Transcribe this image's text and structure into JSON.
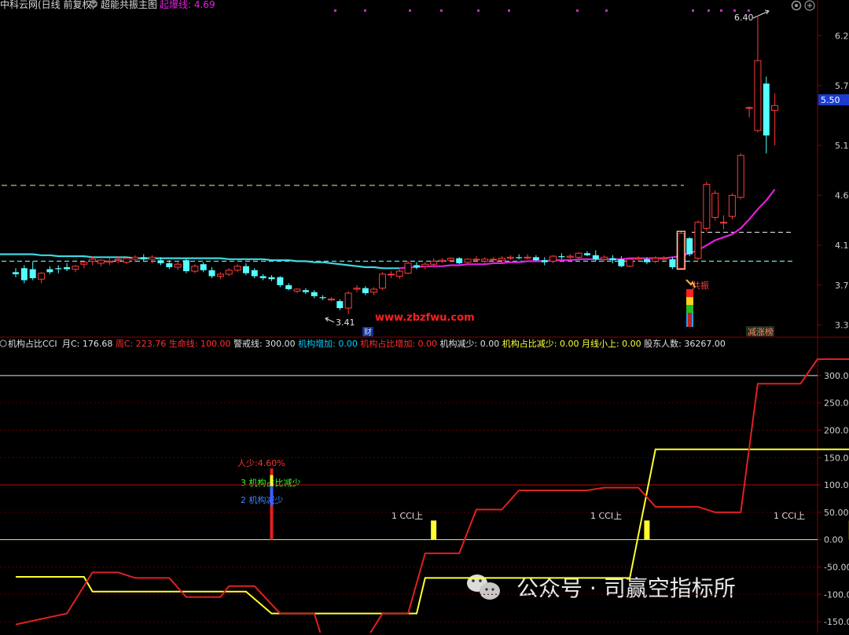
{
  "top_bar": {
    "app_text": "中科云网(日线 前复权)",
    "indicator_name": "超能共振主图",
    "breakout_label": "起爆线: 4.69",
    "breakout_value": 4.69,
    "settings_icon": "gear-icon",
    "zoom_icon": "plus-circle-icon"
  },
  "price_axis": {
    "ticks": [
      "6.2",
      "5.7",
      "5.1",
      "4.6",
      "4.1",
      "3.7",
      "3.3"
    ],
    "current_price_label": "5.50"
  },
  "main_annotations": {
    "high_label": "6.40",
    "low_label": "3.41",
    "finance_badge": "财",
    "resonance_label": "共振",
    "dragon_tiger_badge": "减涨榜",
    "watermark": "www.zbzfwu.com"
  },
  "sub_header": {
    "title": "机构占比CCI",
    "items": [
      {
        "label": "月C:",
        "value": "176.68",
        "color": "#e0e0e0"
      },
      {
        "label": "周C:",
        "value": "223.76",
        "color": "#ff3030"
      },
      {
        "label": "生命线:",
        "value": "100.00",
        "color": "#ff3030"
      },
      {
        "label": "警戒线:",
        "value": "300.00",
        "color": "#e0e0e0"
      },
      {
        "label": "机构增加:",
        "value": "0.00",
        "color": "#00cfff"
      },
      {
        "label": "机构占比增加:",
        "value": "0.00",
        "color": "#ff3030"
      },
      {
        "label": "机构减少:",
        "value": "0.00",
        "color": "#e0e0e0"
      },
      {
        "label": "机构占比减少:",
        "value": "0.00",
        "color": "#ffff40"
      },
      {
        "label": "月线小上:",
        "value": "0.00",
        "color": "#ffff40"
      },
      {
        "label": "股东人数:",
        "value": "36267.00",
        "color": "#e0e0e0"
      }
    ]
  },
  "cci_axis": {
    "ticks": [
      "300.00",
      "250.00",
      "200.00",
      "150.00",
      "100.00",
      "50.00",
      "0.00",
      "-50.00",
      "-100.00",
      "-150.00"
    ]
  },
  "cci_annotations": {
    "reduce_pct": "人少:4.60%",
    "ratio_reduce": "3 机构占比减少",
    "inst_reduce": "2 机构减少",
    "cci_up_1": "1 CCI上",
    "cci_up_2": "1 CCI上",
    "cci_up_3": "1 CCI上"
  },
  "footer_watermark": {
    "text": "公众号 · 司赢空指标所",
    "icon": "wechat-icon"
  },
  "colors": {
    "up": "#ff3a3a",
    "down": "#54ffff",
    "ma_cyan": "#3fd8e0",
    "ma_magenta": "#e020e0",
    "dashed_yellow": "#c8b878",
    "grid_red": "#8b0000",
    "monthly_cci": "#ffff30",
    "weekly_cci": "#e02020"
  },
  "chart_data": [
    {
      "type": "candlestick",
      "title": "超能共振主图",
      "ylim": [
        3.25,
        6.4
      ],
      "y_ticks": [
        6.2,
        5.7,
        5.1,
        4.6,
        4.1,
        3.7,
        3.3
      ],
      "candles": [
        {
          "o": 3.83,
          "h": 3.87,
          "l": 3.78,
          "c": 3.81
        },
        {
          "o": 3.87,
          "h": 3.9,
          "l": 3.72,
          "c": 3.75
        },
        {
          "o": 3.86,
          "h": 3.94,
          "l": 3.75,
          "c": 3.77
        },
        {
          "o": 3.76,
          "h": 3.83,
          "l": 3.72,
          "c": 3.82
        },
        {
          "o": 3.86,
          "h": 3.89,
          "l": 3.81,
          "c": 3.83
        },
        {
          "o": 3.87,
          "h": 3.9,
          "l": 3.82,
          "c": 3.86
        },
        {
          "o": 3.88,
          "h": 3.92,
          "l": 3.84,
          "c": 3.86
        },
        {
          "o": 3.86,
          "h": 3.9,
          "l": 3.83,
          "c": 3.89
        },
        {
          "o": 3.91,
          "h": 3.94,
          "l": 3.87,
          "c": 3.93
        },
        {
          "o": 3.94,
          "h": 3.99,
          "l": 3.9,
          "c": 3.96
        },
        {
          "o": 3.92,
          "h": 3.96,
          "l": 3.89,
          "c": 3.95
        },
        {
          "o": 3.93,
          "h": 3.97,
          "l": 3.9,
          "c": 3.94
        },
        {
          "o": 3.95,
          "h": 3.99,
          "l": 3.92,
          "c": 3.96
        },
        {
          "o": 3.93,
          "h": 3.98,
          "l": 3.91,
          "c": 3.97
        },
        {
          "o": 3.96,
          "h": 4.0,
          "l": 3.93,
          "c": 3.98
        },
        {
          "o": 3.98,
          "h": 4.01,
          "l": 3.94,
          "c": 3.96
        },
        {
          "o": 3.96,
          "h": 4.0,
          "l": 3.92,
          "c": 3.98
        },
        {
          "o": 3.95,
          "h": 3.98,
          "l": 3.9,
          "c": 3.92
        },
        {
          "o": 3.92,
          "h": 3.95,
          "l": 3.86,
          "c": 3.88
        },
        {
          "o": 3.88,
          "h": 3.94,
          "l": 3.85,
          "c": 3.91
        },
        {
          "o": 3.95,
          "h": 3.97,
          "l": 3.82,
          "c": 3.84
        },
        {
          "o": 3.84,
          "h": 3.91,
          "l": 3.82,
          "c": 3.89
        },
        {
          "o": 3.91,
          "h": 3.93,
          "l": 3.83,
          "c": 3.85
        },
        {
          "o": 3.85,
          "h": 3.88,
          "l": 3.77,
          "c": 3.79
        },
        {
          "o": 3.79,
          "h": 3.83,
          "l": 3.76,
          "c": 3.81
        },
        {
          "o": 3.81,
          "h": 3.87,
          "l": 3.79,
          "c": 3.85
        },
        {
          "o": 3.85,
          "h": 3.91,
          "l": 3.83,
          "c": 3.89
        },
        {
          "o": 3.89,
          "h": 3.92,
          "l": 3.8,
          "c": 3.82
        },
        {
          "o": 3.85,
          "h": 3.87,
          "l": 3.77,
          "c": 3.79
        },
        {
          "o": 3.79,
          "h": 3.81,
          "l": 3.75,
          "c": 3.77
        },
        {
          "o": 3.78,
          "h": 3.8,
          "l": 3.74,
          "c": 3.76
        },
        {
          "o": 3.78,
          "h": 3.79,
          "l": 3.68,
          "c": 3.7
        },
        {
          "o": 3.7,
          "h": 3.72,
          "l": 3.65,
          "c": 3.66
        },
        {
          "o": 3.64,
          "h": 3.67,
          "l": 3.62,
          "c": 3.66
        },
        {
          "o": 3.65,
          "h": 3.67,
          "l": 3.61,
          "c": 3.63
        },
        {
          "o": 3.63,
          "h": 3.65,
          "l": 3.57,
          "c": 3.59
        },
        {
          "o": 3.58,
          "h": 3.6,
          "l": 3.55,
          "c": 3.57
        },
        {
          "o": 3.56,
          "h": 3.58,
          "l": 3.54,
          "c": 3.56
        },
        {
          "o": 3.54,
          "h": 3.56,
          "l": 3.45,
          "c": 3.47
        },
        {
          "o": 3.47,
          "h": 3.64,
          "l": 3.41,
          "c": 3.62
        },
        {
          "o": 3.66,
          "h": 3.7,
          "l": 3.63,
          "c": 3.67
        },
        {
          "o": 3.67,
          "h": 3.69,
          "l": 3.6,
          "c": 3.62
        },
        {
          "o": 3.63,
          "h": 3.68,
          "l": 3.6,
          "c": 3.66
        },
        {
          "o": 3.67,
          "h": 3.83,
          "l": 3.65,
          "c": 3.81
        },
        {
          "o": 3.81,
          "h": 3.84,
          "l": 3.77,
          "c": 3.81
        },
        {
          "o": 3.79,
          "h": 3.86,
          "l": 3.76,
          "c": 3.84
        },
        {
          "o": 3.82,
          "h": 3.94,
          "l": 3.81,
          "c": 3.92
        },
        {
          "o": 3.9,
          "h": 3.93,
          "l": 3.86,
          "c": 3.88
        },
        {
          "o": 3.89,
          "h": 3.93,
          "l": 3.86,
          "c": 3.91
        },
        {
          "o": 3.91,
          "h": 3.97,
          "l": 3.89,
          "c": 3.94
        },
        {
          "o": 3.94,
          "h": 3.97,
          "l": 3.92,
          "c": 3.95
        },
        {
          "o": 3.95,
          "h": 3.98,
          "l": 3.93,
          "c": 3.97
        },
        {
          "o": 3.97,
          "h": 3.98,
          "l": 3.91,
          "c": 3.92
        },
        {
          "o": 3.93,
          "h": 3.97,
          "l": 3.91,
          "c": 3.96
        },
        {
          "o": 3.96,
          "h": 3.99,
          "l": 3.93,
          "c": 3.96
        },
        {
          "o": 3.94,
          "h": 3.98,
          "l": 3.92,
          "c": 3.96
        },
        {
          "o": 3.96,
          "h": 3.98,
          "l": 3.93,
          "c": 3.96
        },
        {
          "o": 3.95,
          "h": 3.99,
          "l": 3.93,
          "c": 3.97
        },
        {
          "o": 3.97,
          "h": 4.0,
          "l": 3.95,
          "c": 3.98
        },
        {
          "o": 3.98,
          "h": 4.01,
          "l": 3.96,
          "c": 3.97
        },
        {
          "o": 3.98,
          "h": 4.01,
          "l": 3.96,
          "c": 3.98
        },
        {
          "o": 3.98,
          "h": 4.0,
          "l": 3.94,
          "c": 3.95
        },
        {
          "o": 3.95,
          "h": 3.98,
          "l": 3.9,
          "c": 3.93
        },
        {
          "o": 3.94,
          "h": 4.0,
          "l": 3.92,
          "c": 3.99
        },
        {
          "o": 3.99,
          "h": 4.02,
          "l": 3.96,
          "c": 3.98
        },
        {
          "o": 3.98,
          "h": 4.01,
          "l": 3.96,
          "c": 3.99
        },
        {
          "o": 3.98,
          "h": 4.03,
          "l": 3.96,
          "c": 4.02
        },
        {
          "o": 4.02,
          "h": 4.04,
          "l": 3.99,
          "c": 4.0
        },
        {
          "o": 4.0,
          "h": 4.05,
          "l": 3.94,
          "c": 3.96
        },
        {
          "o": 3.96,
          "h": 4.0,
          "l": 3.94,
          "c": 3.98
        },
        {
          "o": 3.97,
          "h": 4.0,
          "l": 3.92,
          "c": 3.95
        },
        {
          "o": 3.96,
          "h": 3.99,
          "l": 3.88,
          "c": 3.89
        },
        {
          "o": 3.89,
          "h": 3.97,
          "l": 3.88,
          "c": 3.96
        },
        {
          "o": 3.96,
          "h": 3.99,
          "l": 3.94,
          "c": 3.97
        },
        {
          "o": 3.96,
          "h": 3.98,
          "l": 3.91,
          "c": 3.93
        },
        {
          "o": 3.94,
          "h": 3.99,
          "l": 3.92,
          "c": 3.97
        },
        {
          "o": 3.96,
          "h": 3.99,
          "l": 3.93,
          "c": 3.97
        },
        {
          "o": 3.96,
          "h": 3.98,
          "l": 3.86,
          "c": 3.88
        },
        {
          "o": 3.87,
          "h": 4.24,
          "l": 3.86,
          "c": 4.22
        },
        {
          "o": 4.17,
          "h": 4.18,
          "l": 3.99,
          "c": 4.01
        },
        {
          "o": 3.97,
          "h": 4.35,
          "l": 3.95,
          "c": 4.33
        },
        {
          "o": 4.27,
          "h": 4.74,
          "l": 4.24,
          "c": 4.71
        },
        {
          "o": 4.38,
          "h": 4.65,
          "l": 4.35,
          "c": 4.62
        },
        {
          "o": 4.33,
          "h": 4.4,
          "l": 4.26,
          "c": 4.33
        },
        {
          "o": 4.39,
          "h": 4.62,
          "l": 4.36,
          "c": 4.6
        },
        {
          "o": 4.58,
          "h": 5.02,
          "l": 4.56,
          "c": 5.0
        },
        {
          "o": 5.48,
          "h": 5.49,
          "l": 5.38,
          "c": 5.48
        },
        {
          "o": 5.25,
          "h": 6.4,
          "l": 5.23,
          "c": 5.95
        },
        {
          "o": 5.72,
          "h": 5.79,
          "l": 5.02,
          "c": 5.2
        },
        {
          "o": 5.45,
          "h": 5.62,
          "l": 5.1,
          "c": 5.5
        }
      ],
      "ma_long": [
        4.01,
        4.01,
        4.01,
        4.0,
        4.0,
        3.99,
        3.99,
        3.99,
        3.99,
        3.98,
        3.98,
        3.98,
        3.98,
        3.98,
        3.97,
        3.97,
        3.97,
        3.97,
        3.97,
        3.97,
        3.97,
        3.97,
        3.97,
        3.97,
        3.97,
        3.96,
        3.96,
        3.96,
        3.96,
        3.96,
        3.95,
        3.95,
        3.95,
        3.94,
        3.94,
        3.93,
        3.93,
        3.92,
        3.91,
        3.9,
        3.89,
        3.88,
        3.88,
        3.87,
        3.87,
        3.87,
        3.88,
        3.88,
        3.89,
        3.89,
        3.89,
        3.9,
        3.9,
        3.91,
        3.91,
        3.91,
        3.92,
        3.92,
        3.93,
        3.93,
        3.94,
        3.94,
        3.94,
        3.95,
        3.95,
        3.95,
        3.96,
        3.96,
        3.96,
        3.96,
        3.96,
        3.96,
        3.97,
        3.97,
        3.97,
        3.97,
        3.97,
        3.98,
        3.99,
        4.02,
        4.05,
        4.1,
        4.15,
        4.18,
        4.21,
        4.27,
        4.36,
        4.46,
        4.55,
        4.66
      ],
      "ma_long_switch_index": 45,
      "dashed_levels": [
        4.7,
        4.23,
        3.94
      ]
    },
    {
      "type": "line",
      "title": "机构占比CCI",
      "ylim": [
        -170,
        340
      ],
      "y_ticks": [
        300,
        250,
        200,
        150,
        100,
        50,
        0,
        -50,
        -100,
        -150
      ],
      "reference_lines": [
        300,
        100,
        0
      ],
      "series": [
        {
          "name": "月C",
          "color": "#ffff30",
          "points": [
            [
              0,
              -68
            ],
            [
              8,
              -68
            ],
            [
              9,
              -95
            ],
            [
              18,
              -95
            ],
            [
              19,
              -95
            ],
            [
              27,
              -95
            ],
            [
              30,
              -135
            ],
            [
              35,
              -135
            ],
            [
              45,
              -135
            ],
            [
              47,
              -135
            ],
            [
              48,
              -70
            ],
            [
              72,
              -70
            ],
            [
              75,
              165
            ],
            [
              100,
              165
            ],
            [
              101,
              176.68
            ]
          ]
        },
        {
          "name": "周C",
          "color": "#e02020",
          "points": [
            [
              0,
              -155
            ],
            [
              6,
              -135
            ],
            [
              9,
              -60
            ],
            [
              12,
              -60
            ],
            [
              14,
              -70
            ],
            [
              18,
              -70
            ],
            [
              20,
              -105
            ],
            [
              24,
              -105
            ],
            [
              25,
              -85
            ],
            [
              28,
              -85
            ],
            [
              31,
              -135
            ],
            [
              35,
              -135
            ],
            [
              36,
              -185
            ],
            [
              41,
              -185
            ],
            [
              43,
              -135
            ],
            [
              46,
              -135
            ],
            [
              48,
              -25
            ],
            [
              52,
              -25
            ],
            [
              54,
              55
            ],
            [
              57,
              55
            ],
            [
              59,
              90
            ],
            [
              67,
              90
            ],
            [
              69,
              95
            ],
            [
              73,
              95
            ],
            [
              75,
              60
            ],
            [
              80,
              60
            ],
            [
              82,
              50
            ],
            [
              85,
              50
            ],
            [
              87,
              285
            ],
            [
              92,
              285
            ],
            [
              94,
              330
            ],
            [
              98,
              330
            ],
            [
              100,
              225
            ],
            [
              101,
              223.76
            ]
          ]
        }
      ],
      "bars": [
        {
          "x": 30,
          "from": 0,
          "to": 130,
          "color": "#e02020"
        },
        {
          "x": 30,
          "from": 62,
          "to": 98,
          "color": "#4060ff"
        },
        {
          "x": 30,
          "from": 98,
          "to": 118,
          "color": "#ffff30"
        },
        {
          "x": 49,
          "from": 0,
          "to": 35,
          "color": "#ffff30"
        },
        {
          "x": 74,
          "from": 0,
          "to": 35,
          "color": "#ffff30"
        },
        {
          "x": 98,
          "from": 0,
          "to": 35,
          "color": "#ffff30"
        }
      ]
    }
  ]
}
